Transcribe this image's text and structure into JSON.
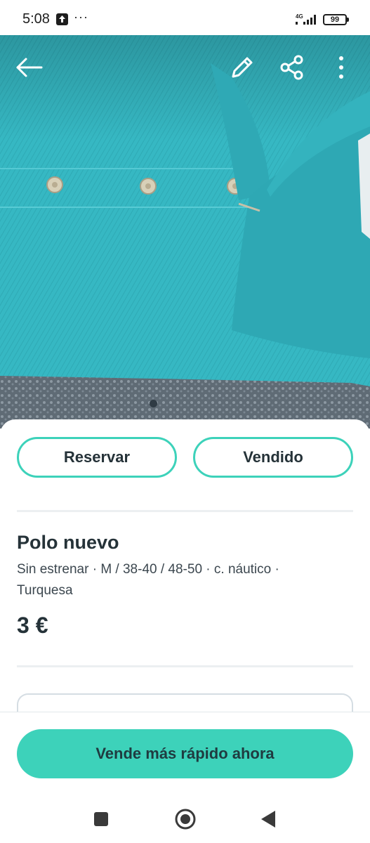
{
  "status_bar": {
    "time": "5:08",
    "dots": "···",
    "network": "4G",
    "battery": "99"
  },
  "photo": {
    "icons": [
      "back-arrow-icon",
      "pencil-icon",
      "share-icon",
      "more-vertical-icon"
    ],
    "colors": {
      "fabric": "#35b9c4",
      "collar": "#2fa9b5"
    },
    "carousel_current": 1
  },
  "actions": {
    "reserve_label": "Reservar",
    "sold_label": "Vendido"
  },
  "product": {
    "title": "Polo nuevo",
    "attributes": "Sin estrenar · M / 38-40 / 48-50 · c. náutico  ·  Turquesa",
    "price": "3 €"
  },
  "bottom": {
    "cta_label": "Vende más rápido ahora"
  },
  "nav": {
    "icons": [
      "recents-square-icon",
      "home-circle-icon",
      "back-triangle-icon"
    ]
  },
  "colors": {
    "accent": "#3dd2ba",
    "text": "#253238",
    "divider": "#eceff1"
  }
}
